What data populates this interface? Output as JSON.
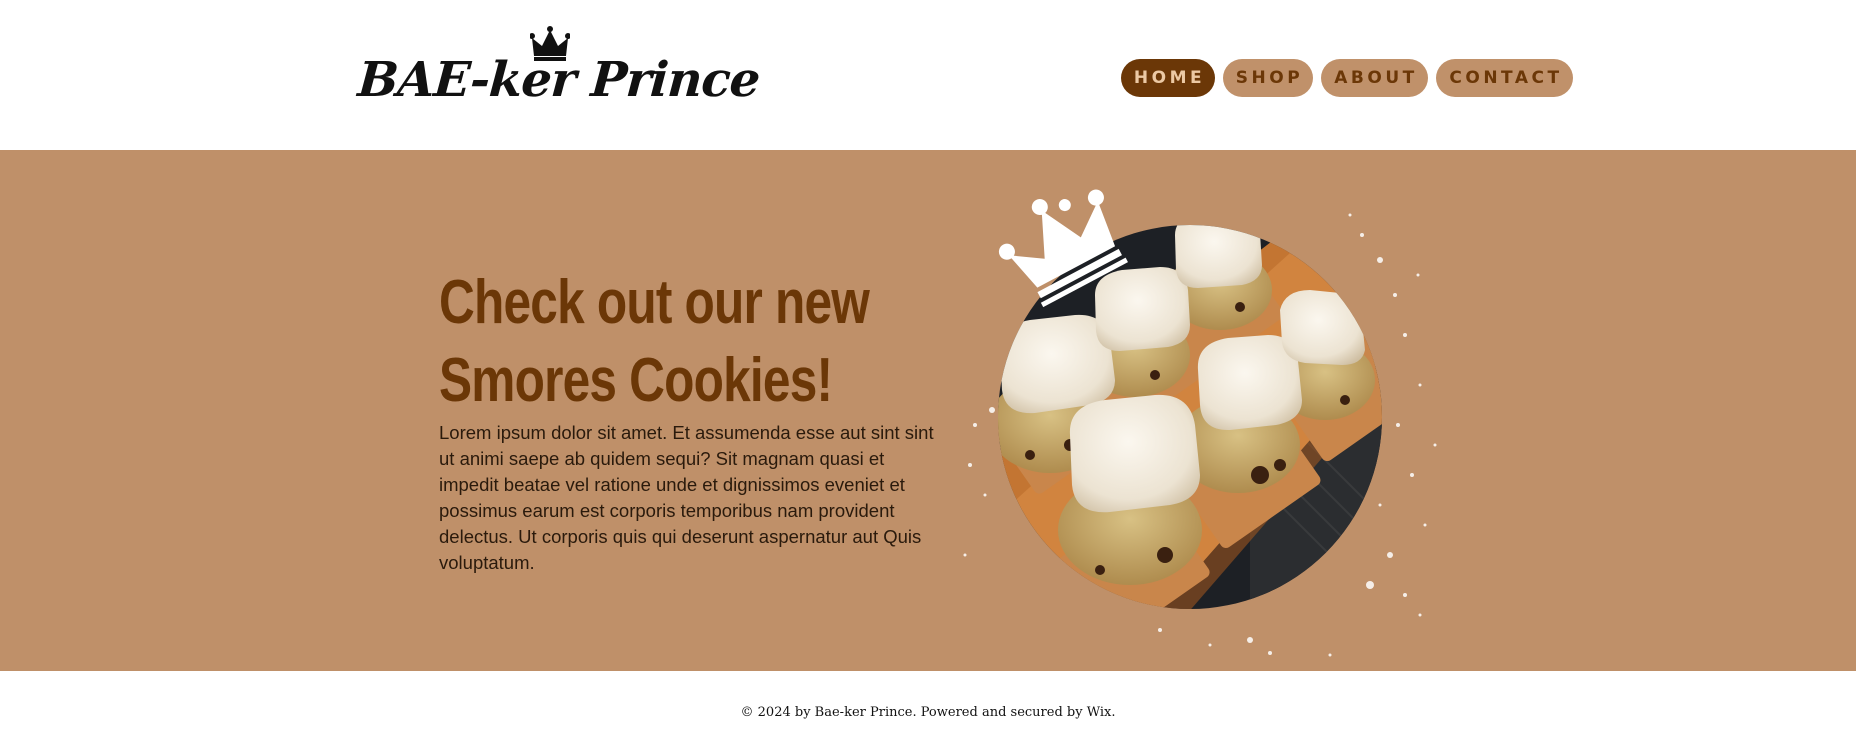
{
  "header": {
    "logo_text": "BAE-ker Prince",
    "logo_icon": "crown-icon",
    "nav": [
      {
        "label": "HOME",
        "active": true
      },
      {
        "label": "SHOP",
        "active": false
      },
      {
        "label": "ABOUT",
        "active": false
      },
      {
        "label": "CONTACT",
        "active": false
      }
    ]
  },
  "hero": {
    "title_line1": "Check out our new",
    "title_line2": "Smores Cookies!",
    "body": "Lorem ipsum dolor sit amet. Et assumenda esse aut sint sint ut animi saepe ab quidem sequi? Sit magnam quasi et impedit beatae vel ratione unde et dignissimos eveniet et possimus earum est corporis temporibus nam provident delectus. Ut corporis quis qui deserunt aspernatur aut Quis voluptatum.",
    "image_subject": "smores-cookies-photo",
    "decoration_icon": "crown-icon"
  },
  "footer": {
    "text": "© 2024 by Bae-ker Prince. Powered and secured by Wix."
  },
  "colors": {
    "brand_brown": "#6b3707",
    "tan": "#bf9069",
    "nav_tan": "#c0916a",
    "white": "#ffffff"
  }
}
